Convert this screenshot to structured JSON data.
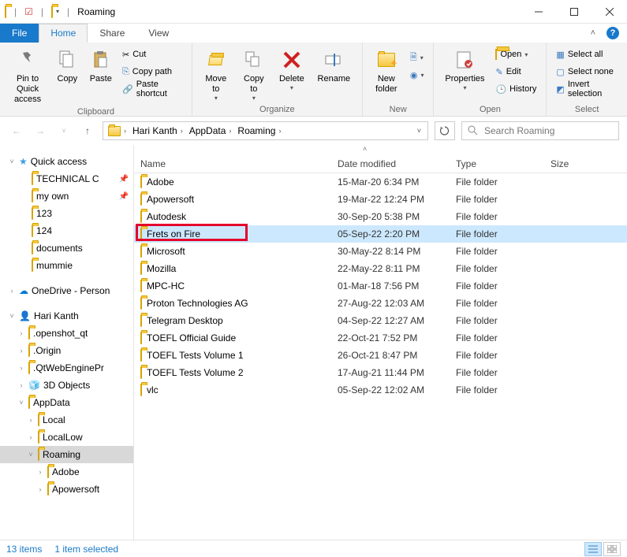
{
  "window": {
    "title": "Roaming"
  },
  "tabs": {
    "file": "File",
    "home": "Home",
    "share": "Share",
    "view": "View"
  },
  "ribbon": {
    "pin": "Pin to Quick\naccess",
    "copy": "Copy",
    "paste": "Paste",
    "cut": "Cut",
    "copypath": "Copy path",
    "pasteshortcut": "Paste shortcut",
    "clipboard": "Clipboard",
    "moveto": "Move\nto",
    "copyto": "Copy\nto",
    "delete": "Delete",
    "rename": "Rename",
    "organize": "Organize",
    "newfolder": "New\nfolder",
    "new": "New",
    "properties": "Properties",
    "open": "Open",
    "openlbl": "Open",
    "edit": "Edit",
    "history": "History",
    "selectall": "Select all",
    "selectnone": "Select none",
    "invertselection": "Invert selection",
    "select": "Select"
  },
  "breadcrumb": [
    "Hari Kanth",
    "AppData",
    "Roaming"
  ],
  "search_placeholder": "Search Roaming",
  "columns": {
    "name": "Name",
    "date": "Date modified",
    "type": "Type",
    "size": "Size"
  },
  "tree": {
    "quick": "Quick access",
    "quick_items": [
      {
        "label": "TECHNICAL C",
        "pinned": true
      },
      {
        "label": "my own",
        "pinned": true
      },
      {
        "label": "123",
        "pinned": false
      },
      {
        "label": "124",
        "pinned": false
      },
      {
        "label": "documents",
        "pinned": false
      },
      {
        "label": "mummie",
        "pinned": false
      }
    ],
    "onedrive": "OneDrive - Person",
    "user": "Hari Kanth",
    "user_items": [
      ".openshot_qt",
      ".Origin",
      ".QtWebEnginePr",
      "3D Objects",
      "AppData"
    ],
    "appdata_items": [
      "Local",
      "LocalLow",
      "Roaming"
    ],
    "roaming_items": [
      "Adobe",
      "Apowersoft"
    ]
  },
  "rows": [
    {
      "name": "Adobe",
      "date": "15-Mar-20 6:34 PM",
      "type": "File folder"
    },
    {
      "name": "Apowersoft",
      "date": "19-Mar-22 12:24 PM",
      "type": "File folder"
    },
    {
      "name": "Autodesk",
      "date": "30-Sep-20 5:38 PM",
      "type": "File folder"
    },
    {
      "name": "Frets on Fire",
      "date": "05-Sep-22 2:20 PM",
      "type": "File folder",
      "selected": true,
      "highlight": true
    },
    {
      "name": "Microsoft",
      "date": "30-May-22 8:14 PM",
      "type": "File folder"
    },
    {
      "name": "Mozilla",
      "date": "22-May-22 8:11 PM",
      "type": "File folder"
    },
    {
      "name": "MPC-HC",
      "date": "01-Mar-18 7:56 PM",
      "type": "File folder"
    },
    {
      "name": "Proton Technologies AG",
      "date": "27-Aug-22 12:03 AM",
      "type": "File folder"
    },
    {
      "name": "Telegram Desktop",
      "date": "04-Sep-22 12:27 AM",
      "type": "File folder"
    },
    {
      "name": "TOEFL Official Guide",
      "date": "22-Oct-21 7:52 PM",
      "type": "File folder"
    },
    {
      "name": "TOEFL Tests Volume 1",
      "date": "26-Oct-21 8:47 PM",
      "type": "File folder"
    },
    {
      "name": "TOEFL Tests Volume 2",
      "date": "17-Aug-21 11:44 PM",
      "type": "File folder"
    },
    {
      "name": "vlc",
      "date": "05-Sep-22 12:02 AM",
      "type": "File folder"
    }
  ],
  "status": {
    "items": "13 items",
    "selected": "1 item selected"
  }
}
